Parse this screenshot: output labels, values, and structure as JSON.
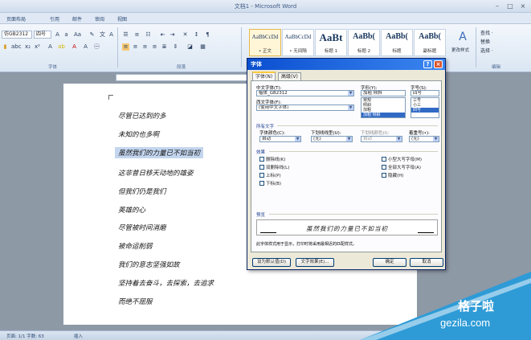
{
  "window": {
    "title": "文档1 - Microsoft Word"
  },
  "ribbon_tabs": [
    "页面布局",
    "引用",
    "邮件",
    "审阅",
    "视图"
  ],
  "ribbon": {
    "font_name": "仿GB2312",
    "font_size": "四号",
    "group_font": "字体",
    "group_paragraph": "段落",
    "group_edit": "编辑",
    "styles": [
      {
        "sample": "AaBbCcDd",
        "name": "• 正文"
      },
      {
        "sample": "AaBbCcDd",
        "name": "• 无间隔"
      },
      {
        "sample": "AaBt",
        "name": "标题 1"
      },
      {
        "sample": "AaBb(",
        "name": "标题 2"
      },
      {
        "sample": "AaBb(",
        "name": "标题"
      },
      {
        "sample": "AaBb(",
        "name": "副标题"
      }
    ],
    "change_styles": "更改样式",
    "edit_items": [
      "查找 ·",
      "替换",
      "选择 ·"
    ]
  },
  "document": {
    "lines": [
      "尽管已达到的多",
      "未知的也多啊",
      "虽然我们的力量已不如当初",
      "这非昔日移天动地的雄姿",
      "但我们仍是我们",
      "英雄的心",
      "尽管被时间消磨",
      "被命运削弱",
      "我们的意志坚强如故",
      "坚持着去奋斗，去探索，去追求",
      "而绝不屈服"
    ],
    "selected_index": 2
  },
  "statusbar": {
    "words": "页面: 1/1  字数: 63",
    "mode": "插入"
  },
  "dialog": {
    "title": "字体",
    "help": "?",
    "close": "×",
    "tabs": [
      "字体(N)",
      "高级(V)"
    ],
    "labels": {
      "cn_font": "中文字体(T):",
      "west_font": "西文字体(F):",
      "style": "字形(Y):",
      "size": "字号(S):",
      "all_text": "所有文字",
      "font_color": "字体颜色(C):",
      "underline_style": "下划线线型(U):",
      "underline_color": "下划线颜色(I):",
      "emphasis": "着重号(•):",
      "effects": "效果",
      "preview": "预览"
    },
    "values": {
      "cn_font": "楷体_GB2312",
      "west_font": "(使用中文字体)",
      "style": "加粗 倾斜",
      "size": "四号",
      "font_color": "自动",
      "underline_style": "(无)",
      "underline_color": "自动",
      "emphasis": "(无)"
    },
    "style_list": [
      "常规",
      "倾斜",
      "加粗",
      "加粗 倾斜"
    ],
    "size_list": [
      "三号",
      "小三",
      "四号"
    ],
    "effects_left": [
      "删除线(K)",
      "双删除线(L)",
      "上标(P)",
      "下标(B)"
    ],
    "effects_right": [
      "小型大写字母(M)",
      "全部大写字母(A)",
      "隐藏(H)"
    ],
    "preview_text": "虽然我们的力量已不如当初",
    "note": "此字体样式用于显示，打印时将采用最相近的匹配样式。",
    "buttons": {
      "set_default": "设为默认值(D)",
      "text_effects": "文字效果(E)...",
      "ok": "确定",
      "cancel": "取消"
    }
  },
  "watermark": {
    "logo": "格子啦",
    "url": "gezila.com",
    "band_color": "#2e9bd6"
  }
}
